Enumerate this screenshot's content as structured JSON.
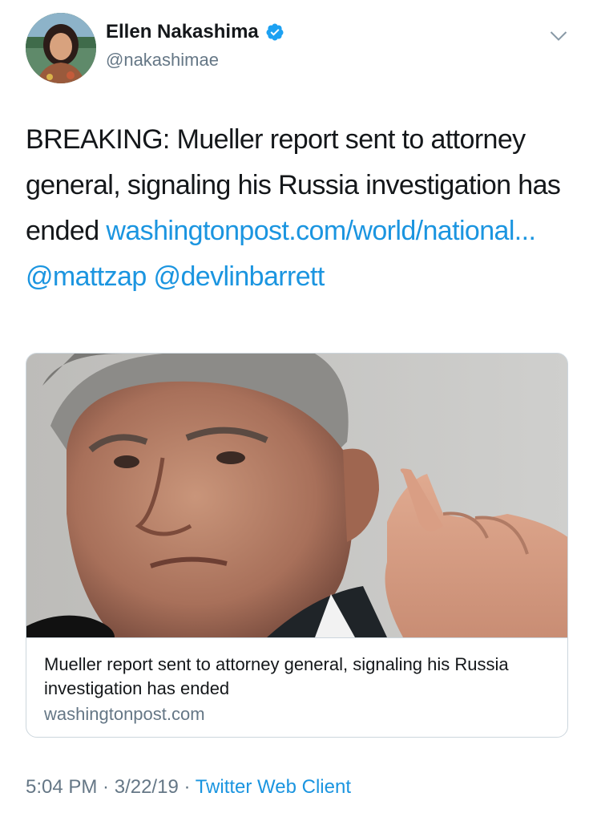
{
  "author": {
    "name": "Ellen Nakashima",
    "handle": "@nakashimae",
    "verified_icon": "verified-badge-icon"
  },
  "menu": {
    "icon": "chevron-down-icon"
  },
  "tweet": {
    "text_plain": "BREAKING: Mueller report sent to attorney general, signaling his Russia investigation has ended",
    "link": "washingtonpost.com/world/national...",
    "mention_1": "@mattzap",
    "mention_2": "@devlinbarrett"
  },
  "card": {
    "title": "Mueller report sent to attorney general, signaling his Russia investigation has ended",
    "domain": "washingtonpost.com"
  },
  "meta": {
    "time": "5:04 PM",
    "sep1": " · ",
    "date": "3/22/19",
    "sep2": " · ",
    "client": "Twitter Web Client"
  },
  "colors": {
    "link": "#1b95e0",
    "secondary_text": "#657786",
    "border": "#ccd6dd"
  }
}
